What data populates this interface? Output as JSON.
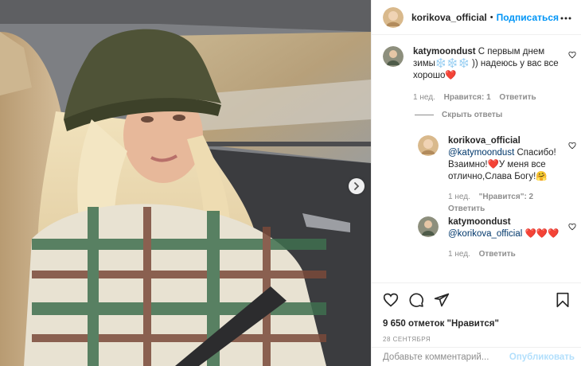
{
  "header": {
    "username": "korikova_official",
    "separator": "•",
    "follow_label": "Подписаться"
  },
  "comments": [
    {
      "username": "katymoondust",
      "text": " С первым днем зимы❄️❄️❄️ )) надеюсь у вас все хорошо❤️",
      "time": "1 нед.",
      "likes": "Нравится: 1",
      "reply_label": "Ответить"
    },
    {
      "username": "korikova_official",
      "mention": "@katymoondust",
      "text": " Спасибо! Взаимно!❤️У меня все отлично,Слава Богу!🤗",
      "time": "1 нед.",
      "likes": "\"Нравится\": 2",
      "reply_label": "Ответить"
    },
    {
      "username": "katymoondust",
      "mention": "@korikova_official",
      "text": " ❤️❤️❤️",
      "time": "1 нед.",
      "reply_label": "Ответить"
    }
  ],
  "hide_replies_label": "Скрыть ответы",
  "post": {
    "likes": "9 650 отметок \"Нравится\"",
    "date": "28 СЕНТЯБРЯ"
  },
  "add_comment": {
    "placeholder": "Добавьте комментарий...",
    "publish_label": "Опубликовать"
  },
  "colors": {
    "accent": "#0095f6",
    "publish_disabled": "#b2dffc",
    "muted": "#8e8e8e",
    "text": "#262626",
    "heart": "#ed4956"
  },
  "icons": [
    "more-icon",
    "heart-icon",
    "comment-icon",
    "share-icon",
    "bookmark-icon",
    "chevron-right-icon"
  ]
}
